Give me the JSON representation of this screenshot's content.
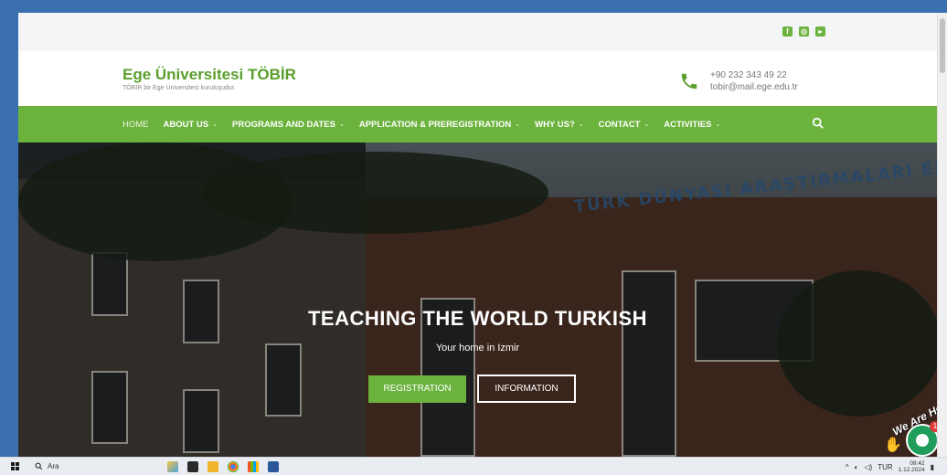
{
  "topbar": {
    "social_icons": [
      "facebook-icon",
      "instagram-icon",
      "youtube-icon"
    ]
  },
  "header": {
    "brand_title": "Ege Üniversitesi TÖBİR",
    "brand_subtitle": "TÖBİR bir Ege Üniversitesi kuruluşudur.",
    "phone": "+90 232 343 49 22",
    "email": "tobir@mail.ege.edu.tr"
  },
  "nav": {
    "items": [
      {
        "label": "HOME"
      },
      {
        "label": "ABOUT US"
      },
      {
        "label": "PROGRAMS AND DATES"
      },
      {
        "label": "APPLICATION & PREREGISTRATION"
      },
      {
        "label": "WHY US?"
      },
      {
        "label": "CONTACT"
      },
      {
        "label": "ACTIVITIES"
      }
    ]
  },
  "hero": {
    "sign_text": "TÜRK DÜNYASI ARAŞTIRMALARI ENS",
    "title": "TEACHING THE WORLD TURKISH",
    "subtitle": "Your home in Izmir",
    "registration_label": "REGISTRATION",
    "information_label": "INFORMATION"
  },
  "chat": {
    "label": "We Are Here!",
    "badge_count": "1"
  },
  "taskbar": {
    "search_placeholder": "Ara",
    "lang": "TUR",
    "time": "09:42",
    "date": "1.12.2024"
  },
  "colors": {
    "accent": "#6cb33e",
    "brand_text": "#5a9e2c"
  }
}
